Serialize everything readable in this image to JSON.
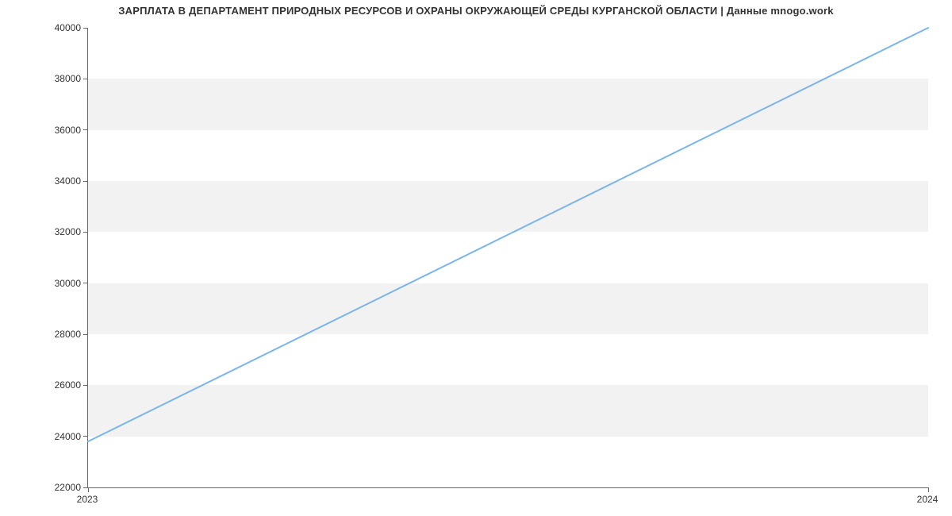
{
  "chart_data": {
    "type": "line",
    "title": "ЗАРПЛАТА В ДЕПАРТАМЕНТ ПРИРОДНЫХ РЕСУРСОВ И ОХРАНЫ ОКРУЖАЮЩЕЙ СРЕДЫ КУРГАНСКОЙ ОБЛАСТИ | Данные mnogo.work",
    "xlabel": "",
    "ylabel": "",
    "x": [
      2023,
      2024
    ],
    "values": [
      23800,
      40000
    ],
    "x_ticks": [
      2023,
      2024
    ],
    "y_ticks": [
      22000,
      24000,
      26000,
      28000,
      30000,
      32000,
      34000,
      36000,
      38000,
      40000
    ],
    "ylim": [
      22000,
      40000
    ],
    "xlim": [
      2023,
      2024
    ],
    "line_color": "#7cb5ec",
    "band_color": "#f2f2f2"
  }
}
